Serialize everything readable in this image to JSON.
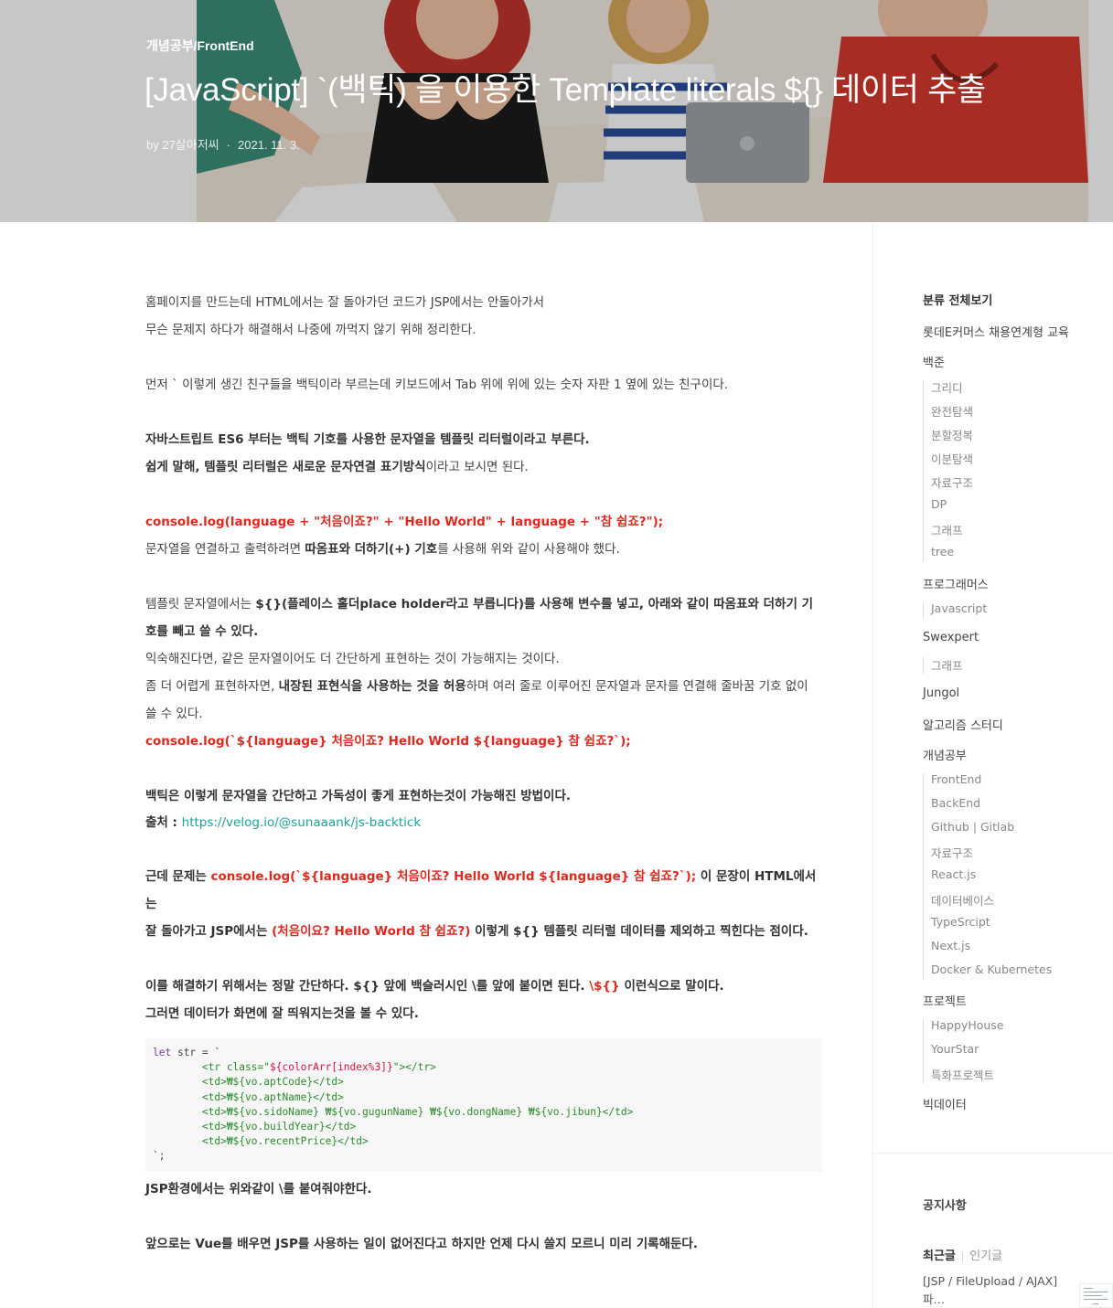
{
  "hero": {
    "category": "개념공부/FrontEnd",
    "title": "[JavaScript] `(백틱) 을 이용한 Template literals ${} 데이터 추출",
    "author": "by 27살아저씨",
    "separator": "·",
    "date": "2021. 11. 3."
  },
  "article": {
    "p1": "홈페이지를 만드는데 HTML에서는 잘 돌아가던 코드가 JSP에서는 안돌아가서",
    "p2": "무슨 문제지 하다가 해결해서 나중에 까먹지 않기 위해 정리한다.",
    "p3": "먼저 ` 이렇게 생긴 친구들을 백틱이라 부르는데 키보드에서 Tab 위에 위에 있는 숫자 자판 1 옆에 있는 친구이다.",
    "p4a": "자바스트립트 ES6 부터는 ",
    "p4b": "백틱 기호를 사용한 문자열",
    "p4c": "을 ",
    "p4d": "템플릿 리터럴",
    "p4e": "이라고 부른다.",
    "p5a": "쉽게 말해, ",
    "p5b": "템플릿 리터럴",
    "p5c": "은 ",
    "p5d": "새로운 문자연결 표기방식",
    "p5e": "이라고 보시면 된다.",
    "code1": "console.log(language + \"처음이죠?\" + \"Hello World\" + language + \"참 쉽죠?\");",
    "p6a": "문자열을 연결하고 출력하려면 ",
    "p6b": "따옴표와 더하기(+) 기호",
    "p6c": "를 사용해 위와 같이 사용해야 했다.",
    "p7a": "템플릿 문자열에서는 ",
    "p7b": "${}(플레이스 홀더place holder라고 부릅니다)를 사용해 변수를 넣고, 아래와 같이 따옴표와 더하기 기호를 빼고 쓸 수 있다.",
    "p8": "익숙해진다면, 같은 문자열이어도 더 간단하게 표현하는 것이 가능해지는 것이다.",
    "p9a": "좀 더 어렵게 표현하자면, ",
    "p9b": "내장된 표현식을 사용하는 것을 허용",
    "p9c": "하며 여러 줄로 이루어진 문자열과 문자를 연결해 줄바꿈 기호 없이 쓸 수 있다.",
    "code2": "console.log(`${language} 처음이죠? Hello World ${language} 참 쉽죠?`);",
    "p10": "백틱은 이렇게 문자열을 간단하고 가독성이 좋게 표현하는것이 가능해진 방법이다.",
    "source_label": "출처 : ",
    "source_url": "https://velog.io/@sunaaank/js-backtick",
    "p11a": "근데 문제는 ",
    "p11b": "console.log(`${language} 처음이죠? Hello World ${language} 참 쉽죠?`);",
    "p11c": " 이 문장이 HTML에서는",
    "p12a": "잘 돌아가고 JSP에서는 ",
    "p12b": "(처음이요? Hello World 참 쉽죠?)",
    "p12c": " 이렇게 ${} 템플릿 리터럴 데이터를 제외하고 찍힌다는 점이다.",
    "p13a": "이를 해결하기 위해서는 정말 간단하다. ${} 앞에 백슬러시인 \\를 앞에 붙이면 된다. ",
    "p13b": "\\${}",
    "p13c": " 이런식으로 말이다.",
    "p14": "그러면 데이터가 화면에 잘 띄워지는것을 볼 수 있다.",
    "code_block": {
      "l1_kw": "let",
      "l1_rest": " str = `",
      "l2a": "        <tr class=\"",
      "l2b": "${colorArr[index%3]}",
      "l2c": "\"></tr>",
      "l3": "        <td>₩${vo.aptCode}</td>",
      "l4": "        <td>₩${vo.aptName}</td>",
      "l5": "        <td>₩${vo.sidoName} ₩${vo.gugunName} ₩${vo.dongName} ₩${vo.jibun}</td>",
      "l6": "        <td>₩${vo.buildYear}</td>",
      "l7": "        <td>₩${vo.recentPrice}</td>",
      "l8": "`;"
    },
    "p15": "JSP환경에서는 위와같이 \\를 붙여줘야한다.",
    "p16": "앞으로는 Vue를 배우면 JSP를 사용하는 일이 없어진다고 하지만 언제 다시 쓸지 모르니 미리 기록해둔다."
  },
  "sidebar": {
    "all_categories": "분류 전체보기",
    "lotte": "롯데E커머스 채용연계형 교육",
    "baekjoon": "백준",
    "baekjoon_sub": [
      "그리디",
      "완전탐색",
      "분할정복",
      "이분탐색",
      "자료구조",
      "DP",
      "그래프",
      "tree"
    ],
    "programmers": "프로그래머스",
    "programmers_sub": [
      "Javascript"
    ],
    "swexpert": "Swexpert",
    "swexpert_sub": [
      "그래프"
    ],
    "jungol": "Jungol",
    "algo_study": "알고리즘 스터디",
    "concepts": "개념공부",
    "concepts_sub": [
      "FrontEnd",
      "BackEnd",
      "Github | Gitlab",
      "자료구조",
      "React.js",
      "데이터베이스",
      "TypeSrcipt",
      "Next.js",
      "Docker & Kubernetes"
    ],
    "project": "프로젝트",
    "project_sub": [
      "HappyHouse",
      "YourStar",
      "특화프로젝트"
    ],
    "bigdata": "빅데이터",
    "notice": "공지사항",
    "recent_tab": "최근글",
    "popular_tab": "인기글",
    "tab_sep": "|",
    "recent_item": "[JSP / FileUpload / AJAX] 파…"
  },
  "colors": {
    "accent_red": "#e0281f",
    "link_teal": "#1aa39b"
  }
}
